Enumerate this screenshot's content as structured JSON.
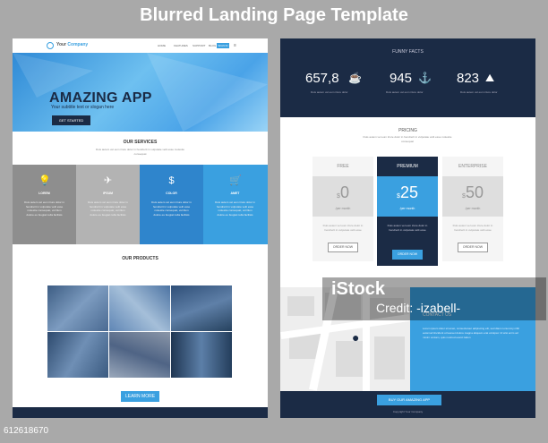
{
  "heading": "Blurred Landing Page Template",
  "left": {
    "nav": {
      "brand_prefix": "Your",
      "brand_name": "Company",
      "links": [
        "HOME",
        "FEATURES",
        "SUPPORT",
        "BLOG"
      ],
      "signin": "SIGN IN"
    },
    "hero": {
      "title": "AMAZING APP",
      "subtitle": "Your subtitle text or slogan here",
      "button": "GET STARTED"
    },
    "services": {
      "title": "OUR SERVICES",
      "intro": "Duis autem vel eum iriure dolor in hendrerit in vulputate velit esse molestie consequat",
      "items": [
        {
          "label": "LOREM",
          "icon": "lightbulb-icon",
          "glyph": "💡",
          "color": "#8e8e8e",
          "text": "Duis autem vel eum iriure dolor in hendrerit in vulputate velit esse molestie consequat, vel illum dolore eu feugiat nulla facilisis"
        },
        {
          "label": "IPSUM",
          "icon": "airplane-icon",
          "glyph": "✈",
          "color": "#b3b3b3",
          "text": "Duis autem vel eum iriure dolor in hendrerit in vulputate velit esse molestie consequat, vel illum dolore eu feugiat nulla facilisis"
        },
        {
          "label": "COLOR",
          "icon": "dollar-icon",
          "glyph": "$",
          "color": "#2f85cc",
          "text": "Duis autem vel eum iriure dolor in hendrerit in vulputate velit esse molestie consequat, vel illum dolore eu feugiat nulla facilisis"
        },
        {
          "label": "AMET",
          "icon": "cart-icon",
          "glyph": "🛒",
          "color": "#3aa0e0",
          "text": "Duis autem vel eum iriure dolor in hendrerit in vulputate velit esse molestie consequat, vel illum dolore eu feugiat nulla facilisis"
        }
      ]
    },
    "products": {
      "title": "OUR PRODUCTS",
      "tiles": [
        "#5b7ea8",
        "#6b8fbf",
        "#4a6c95",
        "#3e5f88",
        "#7a8aa0",
        "#2f4a6b"
      ],
      "button": "LEARN MORE"
    }
  },
  "right": {
    "facts": {
      "title": "FUNNY FACTS",
      "items": [
        {
          "value": "657,8",
          "icon": "coffee-cup-icon",
          "glyph": "☕",
          "desc": "Duis autem vel eum iriure dolor"
        },
        {
          "value": "945",
          "icon": "anchor-icon",
          "glyph": "⚓",
          "desc": "Duis autem vel eum iriure dolor"
        },
        {
          "value": "823",
          "icon": "mountain-icon",
          "glyph": "⛰",
          "desc": "Duis autem vel eum iriure dolor"
        }
      ]
    },
    "pricing": {
      "title": "PRICING",
      "intro": "Duis autem vel eum iriure dolor in hendrerit in vulputate velit esse molestie consequat",
      "plans": [
        {
          "name": "FREE",
          "currency": "$",
          "price": "0",
          "per": "/per month",
          "desc": "Duis autem vel eum iriure dolor in hendrerit in vulputate velit esse",
          "button": "ORDER NOW"
        },
        {
          "name": "PREMIUM",
          "currency": "$",
          "price": "25",
          "per": "/per month",
          "desc": "Duis autem vel eum iriure dolor in hendrerit in vulputate velit esse",
          "button": "ORDER NOW"
        },
        {
          "name": "ENTERPRISE",
          "currency": "$",
          "price": "50",
          "per": "/per month",
          "desc": "Duis autem vel eum iriure dolor in hendrerit in vulputate velit esse",
          "button": "ORDER NOW"
        }
      ]
    },
    "contact": {
      "title": "CONTACT US",
      "text": "Lorem ipsum dolor sit amet, consectetuer adipiscing elit, sed diam nonummy nibh euismod tincidunt ut laoreet dolore magna aliquam erat volutpat. Ut wisi enim ad minim veniam, quis nostrud exerci tation"
    },
    "buy_button": "BUY OUR AMAZING APP",
    "copyright": "Copyright Your Company"
  },
  "watermark": {
    "line1": "iStock",
    "line2": "Credit: -izabell-"
  },
  "stock_id": "612618670",
  "colors": {
    "accent": "#3aa0e0",
    "navy": "#1b2b45",
    "gray": "#8e8e8e"
  }
}
